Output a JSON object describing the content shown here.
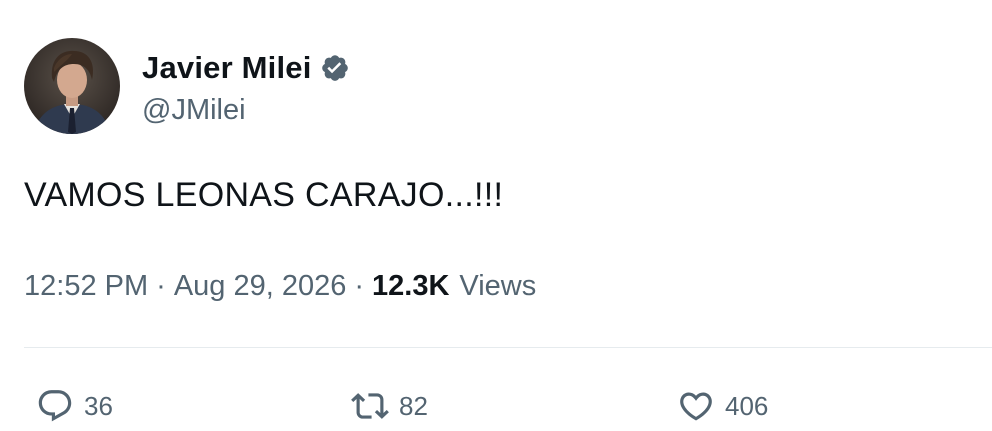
{
  "author": {
    "display_name": "Javier Milei",
    "handle": "@JMilei",
    "verified": true,
    "verified_color": "#536471"
  },
  "tweet": {
    "text": "VAMOS LEONAS CARAJO...!!!",
    "time": "12:52 PM",
    "separator": "·",
    "date": "Aug 29, 2026",
    "views_count": "12.3K",
    "views_label": "Views"
  },
  "actions": {
    "reply": {
      "icon": "reply-icon",
      "count": "36"
    },
    "retweet": {
      "icon": "retweet-icon",
      "count": "82"
    },
    "like": {
      "icon": "heart-icon",
      "count": "406"
    }
  },
  "colors": {
    "text_primary": "#0f1419",
    "text_secondary": "#536471",
    "divider": "#e6ebee"
  }
}
